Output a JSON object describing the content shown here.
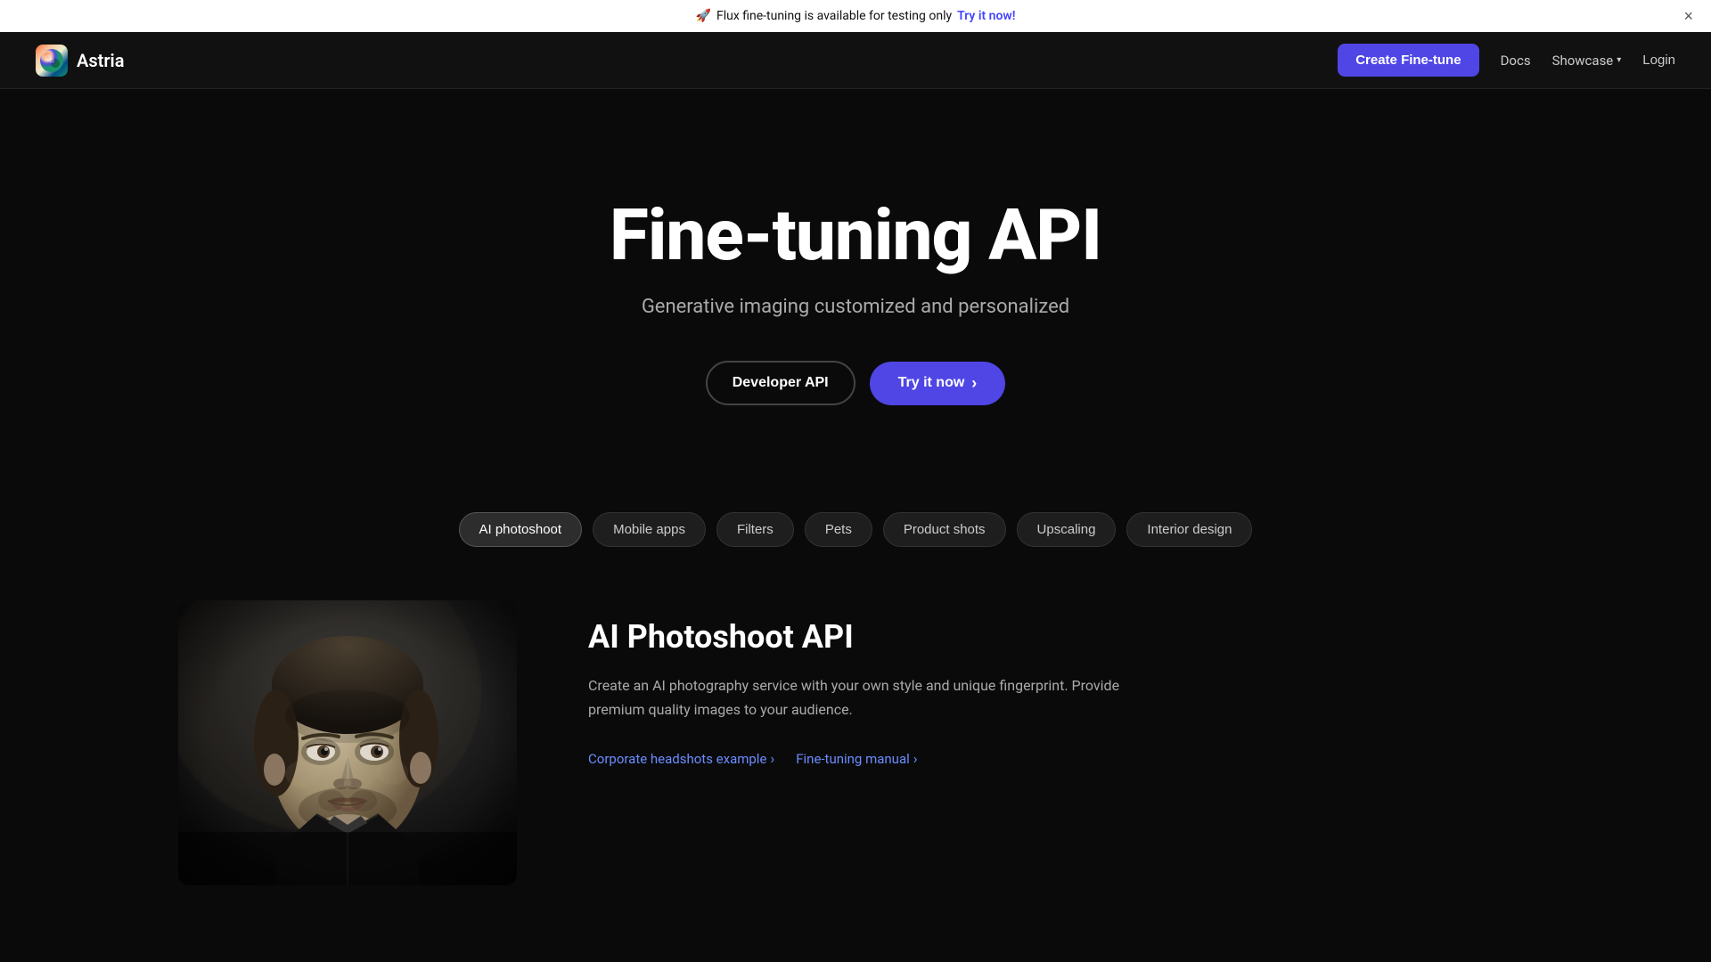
{
  "banner": {
    "emoji": "🚀",
    "text": "Flux fine-tuning is available for testing only",
    "cta": "Try it now!",
    "close_label": "×"
  },
  "navbar": {
    "brand_name": "Astria",
    "create_btn": "Create Fine-tune",
    "docs_label": "Docs",
    "showcase_label": "Showcase",
    "login_label": "Login"
  },
  "hero": {
    "title": "Fine-tuning API",
    "subtitle": "Generative imaging customized and personalized",
    "developer_btn": "Developer API",
    "try_btn": "Try it now"
  },
  "filters": {
    "tabs": [
      {
        "label": "AI photoshoot",
        "active": true
      },
      {
        "label": "Mobile apps",
        "active": false
      },
      {
        "label": "Filters",
        "active": false
      },
      {
        "label": "Pets",
        "active": false
      },
      {
        "label": "Product shots",
        "active": false
      },
      {
        "label": "Upscaling",
        "active": false
      },
      {
        "label": "Interior design",
        "active": false
      }
    ]
  },
  "photoshoot_section": {
    "title": "AI Photoshoot API",
    "description": "Create an AI photography service with your own style and unique fingerprint. Provide premium quality images to your audience.",
    "link1_label": "Corporate headshots example",
    "link2_label": "Fine-tuning manual"
  }
}
